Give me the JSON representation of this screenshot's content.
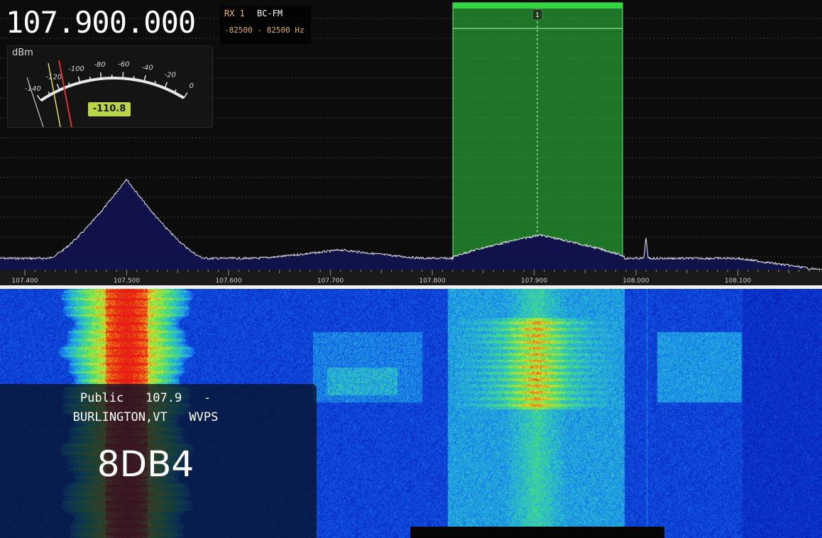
{
  "receiver": {
    "frequency": "107.900.000",
    "rx_label": "RX 1",
    "mode": "BC-FM",
    "bandwidth": "-82500 - 82500 Hz"
  },
  "smeter": {
    "unit": "dBm",
    "scale": [
      "-140",
      "-120",
      "-100",
      "-80",
      "-60",
      "-40",
      "-20",
      "0"
    ],
    "value": "-110.8"
  },
  "vfo": {
    "marker": "1"
  },
  "freq_axis": {
    "ticks": [
      "107.400",
      "107.500",
      "107.600",
      "107.700",
      "107.800",
      "107.900",
      "108.000",
      "108.100"
    ]
  },
  "rds": {
    "line1": "Public   107.9   -",
    "line2": "BURLINGTON,VT   WVPS",
    "pi_code": "8DB4"
  },
  "colors": {
    "accent_green": "#2ecc40",
    "smeter_value_bg": "#b9d64a",
    "rx_label": "#f0c060"
  }
}
